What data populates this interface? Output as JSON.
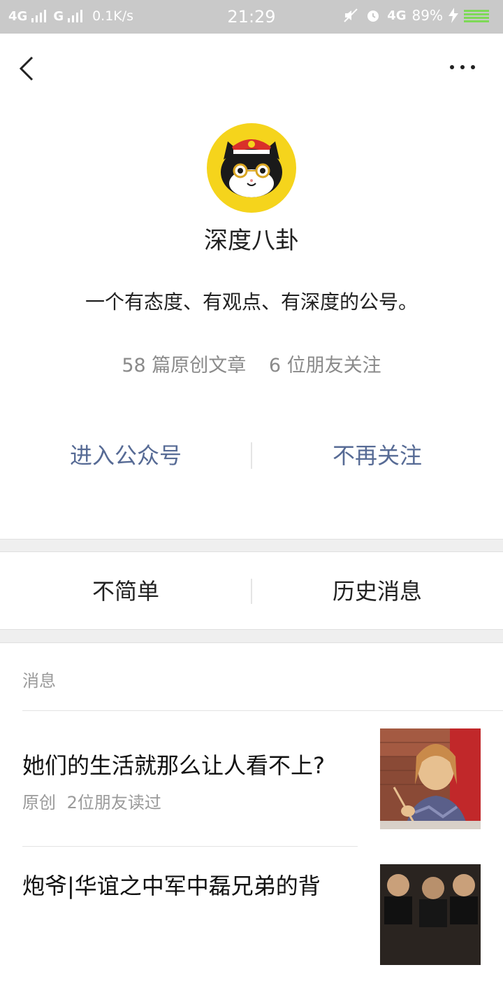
{
  "status_bar": {
    "network1": "4G",
    "network2": "G",
    "speed": "0.1K/s",
    "time": "21:29",
    "network3": "4G",
    "battery": "89%"
  },
  "nav": {
    "back_icon": "chevron-left-icon",
    "more_icon": "more-dots-icon"
  },
  "profile": {
    "name": "深度八卦",
    "description": "一个有态度、有观点、有深度的公号。",
    "original_articles": "58 篇原创文章",
    "friends_following": "6 位朋友关注"
  },
  "actions": {
    "enter": "进入公众号",
    "unfollow": "不再关注"
  },
  "menu": {
    "left": "不简单",
    "right": "历史消息"
  },
  "messages": {
    "section_title": "消息",
    "articles": [
      {
        "title": "她们的生活就那么让人看不上?",
        "tag": "原创",
        "reads": "2位朋友读过"
      },
      {
        "title": "炮爷|华谊之中军中磊兄弟的背"
      }
    ]
  },
  "colors": {
    "link_blue": "#576b95",
    "avatar_yellow": "#f5d41c",
    "status_bar_bg": "#c9c9c9"
  }
}
